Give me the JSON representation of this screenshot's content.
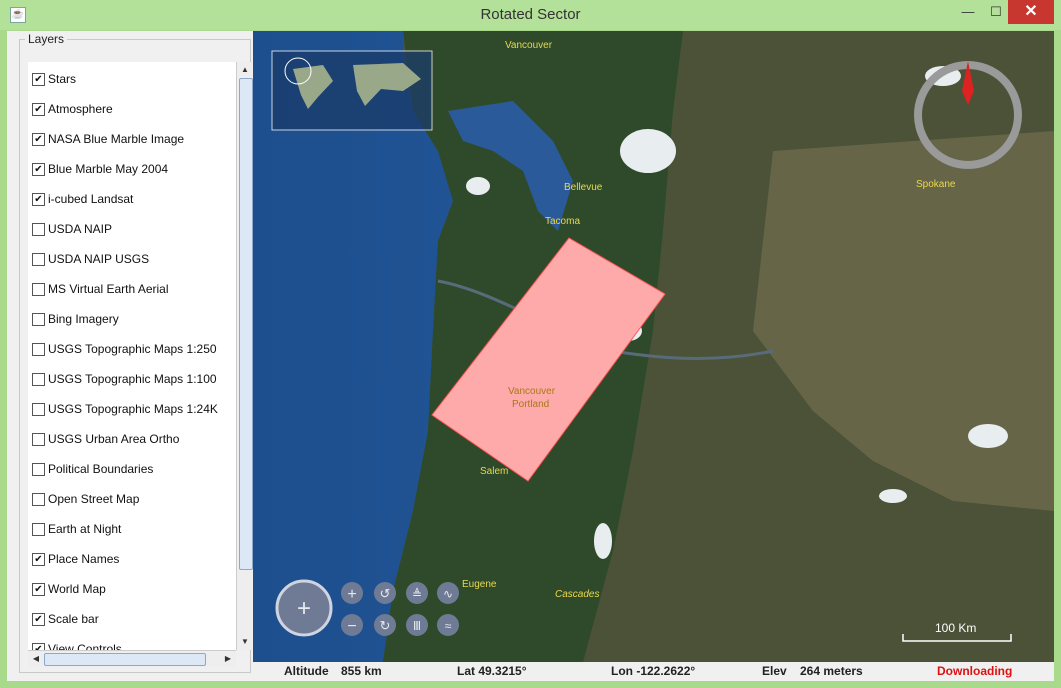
{
  "window": {
    "title": "Rotated Sector",
    "minimize_glyph": "—",
    "maximize_glyph": "☐",
    "close_glyph": "✕"
  },
  "layers_panel": {
    "title": "Layers",
    "items": [
      {
        "label": "Stars",
        "checked": true
      },
      {
        "label": "Atmosphere",
        "checked": true
      },
      {
        "label": "NASA Blue Marble Image",
        "checked": true
      },
      {
        "label": "Blue Marble May 2004",
        "checked": true
      },
      {
        "label": "i-cubed Landsat",
        "checked": true
      },
      {
        "label": "USDA NAIP",
        "checked": false
      },
      {
        "label": "USDA NAIP USGS",
        "checked": false
      },
      {
        "label": "MS Virtual Earth Aerial",
        "checked": false
      },
      {
        "label": "Bing Imagery",
        "checked": false
      },
      {
        "label": "USGS Topographic Maps 1:250",
        "checked": false
      },
      {
        "label": "USGS Topographic Maps 1:100",
        "checked": false
      },
      {
        "label": "USGS Topographic Maps 1:24K",
        "checked": false
      },
      {
        "label": "USGS Urban Area Ortho",
        "checked": false
      },
      {
        "label": "Political Boundaries",
        "checked": false
      },
      {
        "label": "Open Street Map",
        "checked": false
      },
      {
        "label": "Earth at Night",
        "checked": false
      },
      {
        "label": "Place Names",
        "checked": true
      },
      {
        "label": "World Map",
        "checked": true
      },
      {
        "label": "Scale bar",
        "checked": true
      },
      {
        "label": "View Controls",
        "checked": true
      }
    ]
  },
  "map": {
    "places": {
      "vancouver_bc": "Vancouver",
      "bellevue": "Bellevue",
      "tacoma": "Tacoma",
      "spokane": "Spokane",
      "sector_label_1": "Vancouver",
      "sector_label_2": "Portland",
      "salem": "Salem",
      "eugene": "Eugene",
      "cascades": "Cascades"
    },
    "scale_bar_label": "100 Km",
    "sector_color": "#ffaaaa",
    "compass_needle_color": "#dd2222"
  },
  "status": {
    "altitude_label": "Altitude",
    "altitude_value": "855 km",
    "lat": "Lat 49.3215°",
    "lon": "Lon -122.2622°",
    "elev_label": "Elev",
    "elev_value": "264 meters",
    "download_state": "Downloading"
  }
}
